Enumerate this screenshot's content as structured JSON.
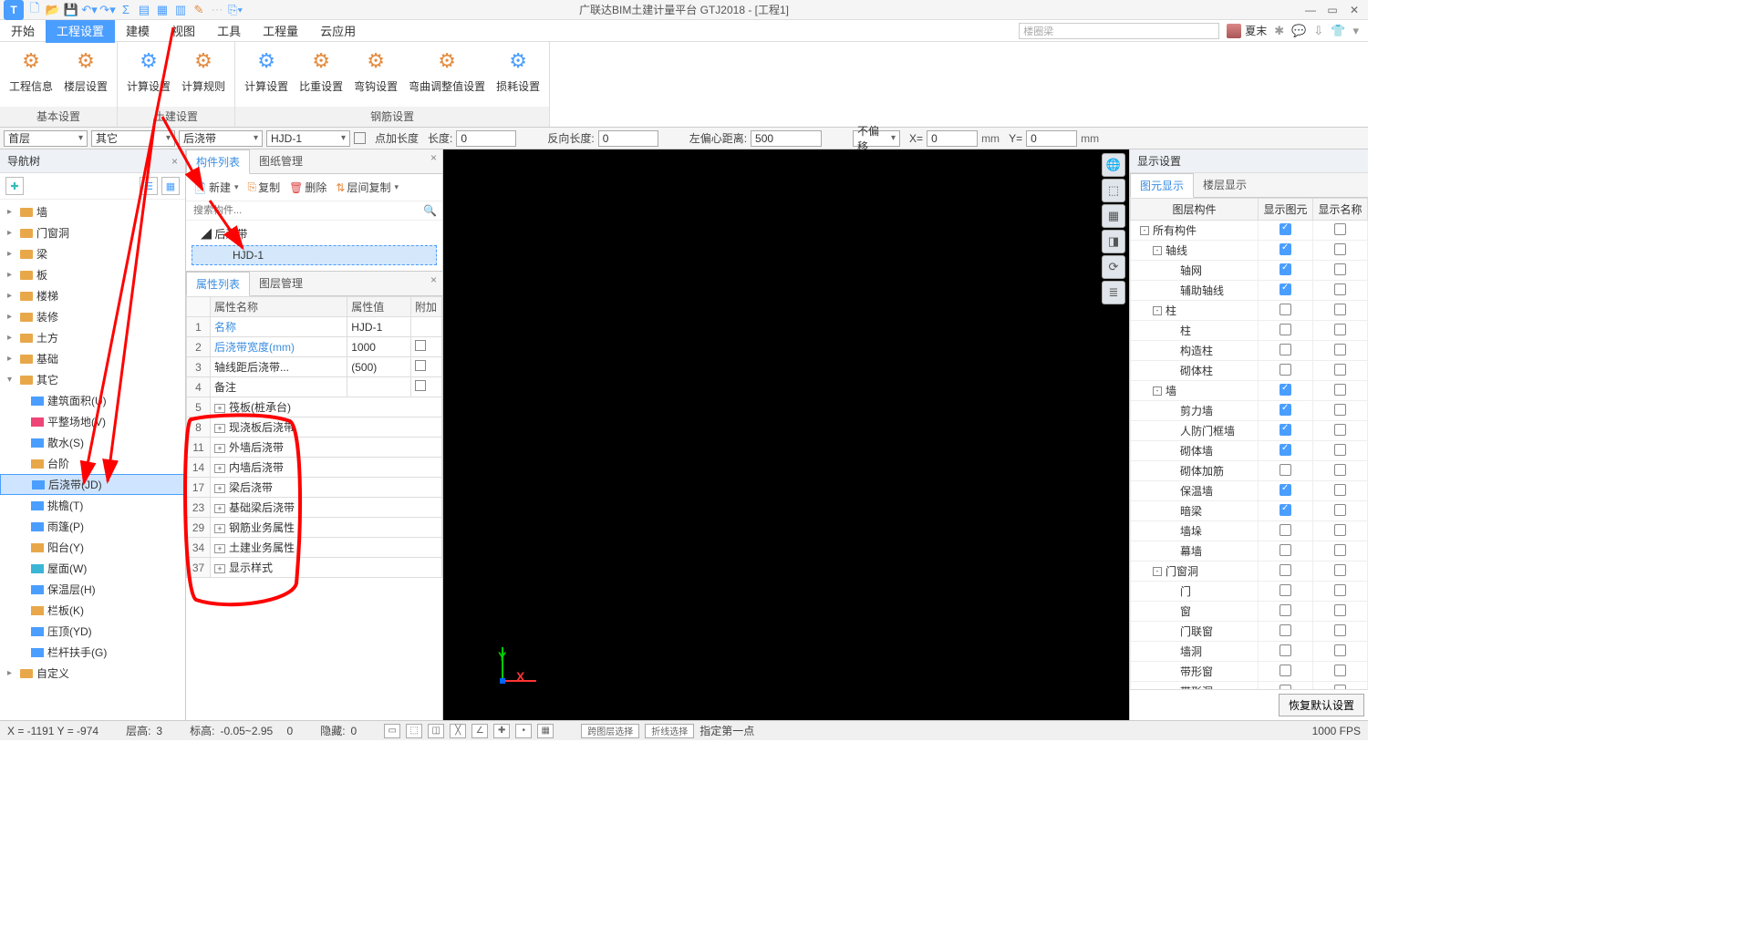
{
  "app": {
    "title": "广联达BIM土建计量平台 GTJ2018 - [工程1]"
  },
  "menutabs": [
    "开始",
    "工程设置",
    "建模",
    "视图",
    "工具",
    "工程量",
    "云应用"
  ],
  "menutab_active": 1,
  "search_placeholder": "楼圈梁",
  "user_name": "夏末",
  "ribbon": {
    "groups": [
      {
        "label": "基本设置",
        "buttons": [
          "工程信息",
          "楼层设置"
        ]
      },
      {
        "label": "土建设置",
        "buttons": [
          "计算设置",
          "计算规则"
        ]
      },
      {
        "label": "钢筋设置",
        "buttons": [
          "计算设置",
          "比重设置",
          "弯钩设置",
          "弯曲调整值设置",
          "损耗设置"
        ]
      }
    ]
  },
  "params": {
    "floor": "首层",
    "category": "其它",
    "type": "后浇带",
    "name": "HJD-1",
    "dianjia_label": "点加长度",
    "len_label": "长度:",
    "len_val": "0",
    "fanlen_label": "反向长度:",
    "fanlen_val": "0",
    "leftoff_label": "左偏心距离:",
    "leftoff_val": "500",
    "offset_sel": "不偏移",
    "x_label": "X=",
    "x_val": "0",
    "x_unit": "mm",
    "y_label": "Y=",
    "y_val": "0",
    "y_unit": "mm"
  },
  "nav": {
    "title": "导航树",
    "items_l1": [
      {
        "label": "墙"
      },
      {
        "label": "门窗洞"
      },
      {
        "label": "梁"
      },
      {
        "label": "板"
      },
      {
        "label": "楼梯"
      },
      {
        "label": "装修"
      },
      {
        "label": "土方"
      },
      {
        "label": "基础"
      }
    ],
    "other_label": "其它",
    "other_children": [
      {
        "label": "建筑面积(U)",
        "color": "#4a9eff"
      },
      {
        "label": "平整场地(V)",
        "color": "#e47"
      },
      {
        "label": "散水(S)",
        "color": "#4a9eff"
      },
      {
        "label": "台阶",
        "color": "#e8a84a"
      },
      {
        "label": "后浇带(JD)",
        "selected": true,
        "color": "#4a9eff"
      },
      {
        "label": "挑檐(T)",
        "color": "#4a9eff"
      },
      {
        "label": "雨篷(P)",
        "color": "#4a9eff"
      },
      {
        "label": "阳台(Y)",
        "color": "#e8a84a"
      },
      {
        "label": "屋面(W)",
        "color": "#3bb5d6"
      },
      {
        "label": "保温层(H)",
        "color": "#4a9eff"
      },
      {
        "label": "栏板(K)",
        "color": "#e8a84a"
      },
      {
        "label": "压顶(YD)",
        "color": "#4a9eff"
      },
      {
        "label": "栏杆扶手(G)",
        "color": "#4a9eff"
      }
    ],
    "custom_label": "自定义"
  },
  "comp": {
    "tabs": [
      "构件列表",
      "图纸管理"
    ],
    "toolbar": {
      "new": "新建",
      "copy": "复制",
      "delete": "删除",
      "layercopy": "层间复制"
    },
    "search_placeholder": "搜索构件...",
    "root": "后浇带",
    "leaf": "HJD-1"
  },
  "prop": {
    "tabs": [
      "属性列表",
      "图层管理"
    ],
    "headers": {
      "name": "属性名称",
      "value": "属性值",
      "add": "附加"
    },
    "rows": [
      {
        "n": "1",
        "name": "名称",
        "value": "HJD-1",
        "add": false,
        "blue": true
      },
      {
        "n": "2",
        "name": "后浇带宽度(mm)",
        "value": "1000",
        "add": true,
        "blue": true
      },
      {
        "n": "3",
        "name": "轴线距后浇带...",
        "value": "(500)",
        "add": true,
        "blue": false
      },
      {
        "n": "4",
        "name": "备注",
        "value": "",
        "add": true,
        "blue": false
      },
      {
        "n": "5",
        "name": "筏板(桩承台)",
        "expand": true
      },
      {
        "n": "8",
        "name": "现浇板后浇带",
        "expand": true
      },
      {
        "n": "11",
        "name": "外墙后浇带",
        "expand": true
      },
      {
        "n": "14",
        "name": "内墙后浇带",
        "expand": true
      },
      {
        "n": "17",
        "name": "梁后浇带",
        "expand": true
      },
      {
        "n": "23",
        "name": "基础梁后浇带",
        "expand": true
      },
      {
        "n": "29",
        "name": "钢筋业务属性",
        "expand": true
      },
      {
        "n": "34",
        "name": "土建业务属性",
        "expand": true
      },
      {
        "n": "37",
        "name": "显示样式",
        "expand": true
      }
    ]
  },
  "disp": {
    "title": "显示设置",
    "tabs": [
      "图元显示",
      "楼层显示"
    ],
    "headers": {
      "layer": "图层构件",
      "show": "显示图元",
      "name": "显示名称"
    },
    "rows": [
      {
        "label": "所有构件",
        "level": 0,
        "fold": "-",
        "show": "on",
        "name": "off"
      },
      {
        "label": "轴线",
        "level": 1,
        "fold": "-",
        "show": "on",
        "name": "off"
      },
      {
        "label": "轴网",
        "level": 2,
        "show": "on",
        "name": "off"
      },
      {
        "label": "辅助轴线",
        "level": 2,
        "show": "on",
        "name": "off"
      },
      {
        "label": "柱",
        "level": 1,
        "fold": "-",
        "show": "off",
        "name": "off"
      },
      {
        "label": "柱",
        "level": 2,
        "show": "off",
        "name": "off"
      },
      {
        "label": "构造柱",
        "level": 2,
        "show": "off",
        "name": "off"
      },
      {
        "label": "砌体柱",
        "level": 2,
        "show": "off",
        "name": "off"
      },
      {
        "label": "墙",
        "level": 1,
        "fold": "-",
        "show": "on",
        "name": "off"
      },
      {
        "label": "剪力墙",
        "level": 2,
        "show": "on",
        "name": "off"
      },
      {
        "label": "人防门框墙",
        "level": 2,
        "show": "on",
        "name": "off"
      },
      {
        "label": "砌体墙",
        "level": 2,
        "show": "on",
        "name": "off"
      },
      {
        "label": "砌体加筋",
        "level": 2,
        "show": "off",
        "name": "off"
      },
      {
        "label": "保温墙",
        "level": 2,
        "show": "on",
        "name": "off"
      },
      {
        "label": "暗梁",
        "level": 2,
        "show": "on",
        "name": "off"
      },
      {
        "label": "墙垛",
        "level": 2,
        "show": "off",
        "name": "off"
      },
      {
        "label": "幕墙",
        "level": 2,
        "show": "off",
        "name": "off"
      },
      {
        "label": "门窗洞",
        "level": 1,
        "fold": "-",
        "show": "off",
        "name": "off"
      },
      {
        "label": "门",
        "level": 2,
        "show": "off",
        "name": "off"
      },
      {
        "label": "窗",
        "level": 2,
        "show": "off",
        "name": "off"
      },
      {
        "label": "门联窗",
        "level": 2,
        "show": "off",
        "name": "off"
      },
      {
        "label": "墙洞",
        "level": 2,
        "show": "off",
        "name": "off"
      },
      {
        "label": "带形窗",
        "level": 2,
        "show": "off",
        "name": "off"
      },
      {
        "label": "带形洞",
        "level": 2,
        "show": "off",
        "name": "off"
      }
    ],
    "restore": "恢复默认设置"
  },
  "status": {
    "coord": "X = -1191 Y = -974",
    "floor_label": "层高:",
    "floor_val": "3",
    "elev_label": "标高:",
    "elev_val": "-0.05~2.95",
    "elev_n": "0",
    "hide_label": "隐藏:",
    "hide_val": "0",
    "btn1": "跨图层选择",
    "btn2": "折线选择",
    "btn3": "指定第一点",
    "fps": "1000 FPS"
  }
}
